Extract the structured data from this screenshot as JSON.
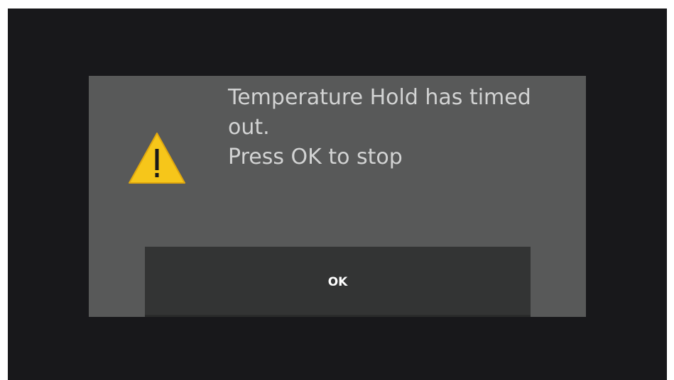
{
  "dialog": {
    "message_lines": [
      "Temperature Hold has timed",
      "out.",
      "Press OK to stop"
    ],
    "icon": "warning-triangle-icon",
    "ok_label": "OK"
  },
  "colors": {
    "screen_background": "#18181b",
    "dialog_background": "#585959",
    "button_background": "#333434",
    "warning_yellow": "#f6c61a",
    "text": "#d2d3d3"
  }
}
